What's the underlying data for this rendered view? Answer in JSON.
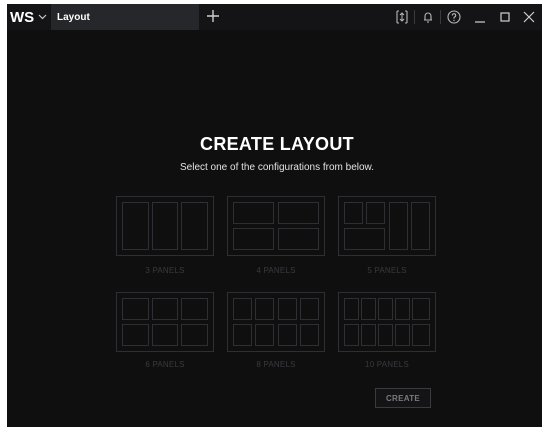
{
  "app": {
    "logo": "WS",
    "menu_icon": "chevron-down-icon"
  },
  "tabs": [
    {
      "label": "Layout"
    }
  ],
  "titlebar_icons": [
    "layout-select-icon",
    "bell-icon",
    "help-icon",
    "minimize-icon",
    "maximize-icon",
    "close-icon"
  ],
  "main": {
    "title": "CREATE LAYOUT",
    "subtitle": "Select one of the configurations from below.",
    "options": [
      {
        "label": "3 PANELS"
      },
      {
        "label": "4 PANELS"
      },
      {
        "label": "5 PANELS"
      },
      {
        "label": "6 PANELS"
      },
      {
        "label": "8 PANELS"
      },
      {
        "label": "10 PANELS"
      }
    ],
    "create_button": "CREATE"
  },
  "colors": {
    "window_bg": "#0f0f10",
    "titlebar_bg": "#141416",
    "active_tab_bg": "#26272a",
    "panel_outline": "#2f2f33",
    "muted_label": "#3a3a3e"
  }
}
